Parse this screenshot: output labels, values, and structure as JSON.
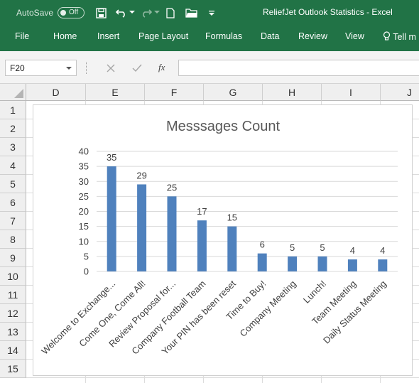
{
  "titlebar": {
    "autosave_label": "AutoSave",
    "autosave_state": "Off",
    "document_title": "ReliefJet Outlook Statistics  -  Excel"
  },
  "quick_access": [
    {
      "icon": "save-icon"
    },
    {
      "icon": "undo-icon"
    },
    {
      "icon": "redo-icon"
    },
    {
      "icon": "new-file-icon"
    },
    {
      "icon": "open-folder-icon"
    },
    {
      "icon": "customize-icon"
    }
  ],
  "ribbon": {
    "tabs": [
      "File",
      "Home",
      "Insert",
      "Page Layout",
      "Formulas",
      "Data",
      "Review",
      "View"
    ],
    "tell_me": "Tell m"
  },
  "formula_bar": {
    "name_box": "F20",
    "fx_label": "fx",
    "formula": ""
  },
  "columns": [
    "D",
    "E",
    "F",
    "G",
    "H",
    "I",
    "J"
  ],
  "rows": [
    "1",
    "2",
    "3",
    "4",
    "5",
    "6",
    "7",
    "8",
    "9",
    "10",
    "11",
    "12",
    "13",
    "14",
    "15"
  ],
  "colors": {
    "excel_green": "#217346",
    "bar": "#4f81bd"
  },
  "chart_data": {
    "type": "bar",
    "title": "Messsages Count",
    "categories": [
      "Welcome to Exchange...",
      "Come One, Come All!",
      "Review Proposal for...",
      "Company Football Team",
      "Your PIN has been reset",
      "Time to Buy!",
      "Company Meeting",
      "Lunch!",
      "Team Meeting",
      "Daily Status Meeting"
    ],
    "values": [
      35,
      29,
      25,
      17,
      15,
      6,
      5,
      5,
      4,
      4
    ],
    "ylim": [
      0,
      40
    ],
    "yticks": [
      0,
      5,
      10,
      15,
      20,
      25,
      30,
      35,
      40
    ],
    "grid": true,
    "legend": "none",
    "data_labels": true
  }
}
